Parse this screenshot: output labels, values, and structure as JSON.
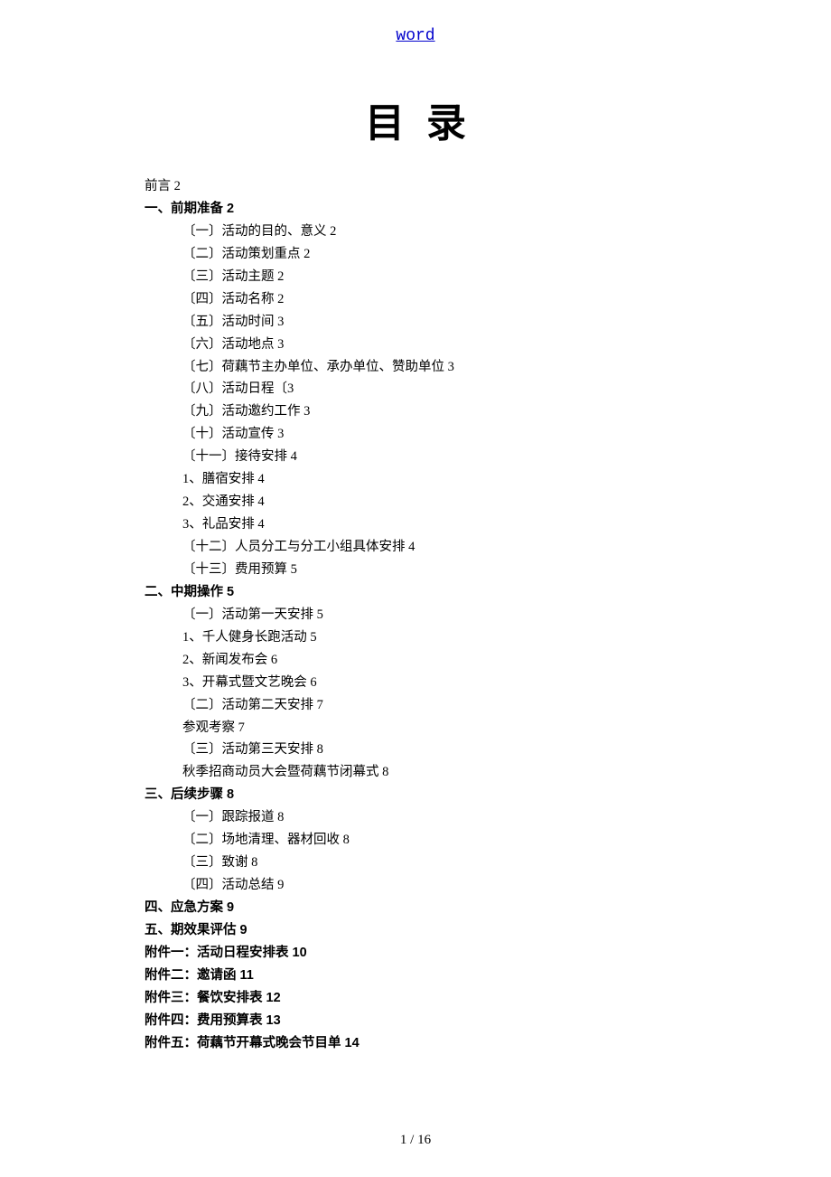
{
  "header": {
    "link_text": "word"
  },
  "title": "目录",
  "toc_items": [
    {
      "text": "前言 2",
      "level": 0,
      "bold": false
    },
    {
      "text": "一、前期准备 2",
      "level": 0,
      "bold": true
    },
    {
      "text": "〔一〕活动的目的、意义 2",
      "level": 1,
      "bold": false
    },
    {
      "text": "〔二〕活动策划重点 2",
      "level": 1,
      "bold": false
    },
    {
      "text": "〔三〕活动主题 2",
      "level": 1,
      "bold": false
    },
    {
      "text": "〔四〕活动名称 2",
      "level": 1,
      "bold": false
    },
    {
      "text": "〔五〕活动时间 3",
      "level": 1,
      "bold": false
    },
    {
      "text": "〔六〕活动地点 3",
      "level": 1,
      "bold": false
    },
    {
      "text": "〔七〕荷藕节主办单位、承办单位、赞助单位 3",
      "level": 1,
      "bold": false
    },
    {
      "text": "〔八〕活动日程〔3",
      "level": 1,
      "bold": false
    },
    {
      "text": "〔九〕活动邀约工作 3",
      "level": 1,
      "bold": false
    },
    {
      "text": "〔十〕活动宣传 3",
      "level": 1,
      "bold": false
    },
    {
      "text": "〔十一〕接待安排 4",
      "level": 1,
      "bold": false
    },
    {
      "text": "1、膳宿安排 4",
      "level": 1,
      "bold": false
    },
    {
      "text": "2、交通安排 4",
      "level": 1,
      "bold": false
    },
    {
      "text": "3、礼品安排 4",
      "level": 1,
      "bold": false
    },
    {
      "text": "〔十二〕人员分工与分工小组具体安排 4",
      "level": 1,
      "bold": false
    },
    {
      "text": "〔十三〕费用预算 5",
      "level": 1,
      "bold": false
    },
    {
      "text": "二、中期操作 5",
      "level": 0,
      "bold": true
    },
    {
      "text": "〔一〕活动第一天安排 5",
      "level": 1,
      "bold": false
    },
    {
      "text": "1、千人健身长跑活动 5",
      "level": 1,
      "bold": false
    },
    {
      "text": "2、新闻发布会 6",
      "level": 1,
      "bold": false
    },
    {
      "text": "3、开幕式暨文艺晚会 6",
      "level": 1,
      "bold": false
    },
    {
      "text": "〔二〕活动第二天安排 7",
      "level": 1,
      "bold": false
    },
    {
      "text": "参观考察 7",
      "level": 1,
      "bold": false
    },
    {
      "text": "〔三〕活动第三天安排 8",
      "level": 1,
      "bold": false
    },
    {
      "text": "秋季招商动员大会暨荷藕节闭幕式 8",
      "level": 1,
      "bold": false
    },
    {
      "text": "三、后续步骤 8",
      "level": 0,
      "bold": true
    },
    {
      "text": "〔一〕跟踪报道 8",
      "level": 1,
      "bold": false
    },
    {
      "text": "〔二〕场地清理、器材回收 8",
      "level": 1,
      "bold": false
    },
    {
      "text": "〔三〕致谢 8",
      "level": 1,
      "bold": false
    },
    {
      "text": "〔四〕活动总结 9",
      "level": 1,
      "bold": false
    },
    {
      "text": "四、应急方案 9",
      "level": 0,
      "bold": true
    },
    {
      "text": "五、期效果评估 9",
      "level": 0,
      "bold": true
    },
    {
      "text": "附件一：活动日程安排表 10",
      "level": 0,
      "bold": true
    },
    {
      "text": "附件二：邀请函 11",
      "level": 0,
      "bold": true
    },
    {
      "text": "附件三：餐饮安排表 12",
      "level": 0,
      "bold": true
    },
    {
      "text": "附件四：费用预算表 13",
      "level": 0,
      "bold": true
    },
    {
      "text": "附件五：荷藕节开幕式晚会节目单 14",
      "level": 0,
      "bold": true
    }
  ],
  "footer": {
    "page_number": "1 / 16"
  }
}
